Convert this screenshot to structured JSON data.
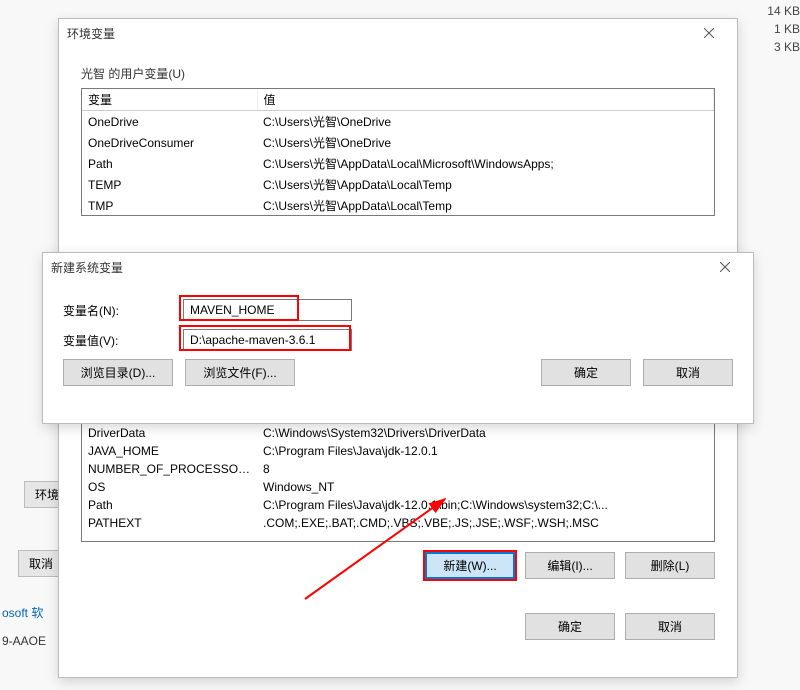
{
  "bg": {
    "sizes": [
      "14 KB",
      "1 KB",
      "3 KB"
    ],
    "env_button": "环境",
    "cancel_button": "取消",
    "link": "osoft 软",
    "text9": "9-AAOE"
  },
  "envDialog": {
    "title": "环境变量",
    "userGroupLabel": "光智 的用户变量(U)",
    "headers": {
      "var": "变量",
      "val": "值"
    },
    "userVars": [
      {
        "var": "OneDrive",
        "val": "C:\\Users\\光智\\OneDrive"
      },
      {
        "var": "OneDriveConsumer",
        "val": "C:\\Users\\光智\\OneDrive"
      },
      {
        "var": "Path",
        "val": "C:\\Users\\光智\\AppData\\Local\\Microsoft\\WindowsApps;"
      },
      {
        "var": "TEMP",
        "val": "C:\\Users\\光智\\AppData\\Local\\Temp"
      },
      {
        "var": "TMP",
        "val": "C:\\Users\\光智\\AppData\\Local\\Temp"
      }
    ],
    "sysVars": [
      {
        "var": "DriverData",
        "val": "C:\\Windows\\System32\\Drivers\\DriverData"
      },
      {
        "var": "JAVA_HOME",
        "val": "C:\\Program Files\\Java\\jdk-12.0.1"
      },
      {
        "var": "NUMBER_OF_PROCESSORS",
        "val": "8"
      },
      {
        "var": "OS",
        "val": "Windows_NT"
      },
      {
        "var": "Path",
        "val": "C:\\Program Files\\Java\\jdk-12.0.1\\bin;C:\\Windows\\system32;C:\\..."
      },
      {
        "var": "PATHEXT",
        "val": ".COM;.EXE;.BAT;.CMD;.VBS;.VBE;.JS;.JSE;.WSF;.WSH;.MSC"
      }
    ],
    "sysButtons": {
      "new": "新建(W)...",
      "edit": "编辑(I)...",
      "delete": "删除(L)"
    },
    "bottomButtons": {
      "ok": "确定",
      "cancel": "取消"
    }
  },
  "newVarDialog": {
    "title": "新建系统变量",
    "nameLabel": "变量名(N):",
    "nameValue": "MAVEN_HOME",
    "valueLabel": "变量值(V):",
    "valueValue": "D:\\apache-maven-3.6.1",
    "browseDir": "浏览目录(D)...",
    "browseFile": "浏览文件(F)...",
    "ok": "确定",
    "cancel": "取消"
  }
}
